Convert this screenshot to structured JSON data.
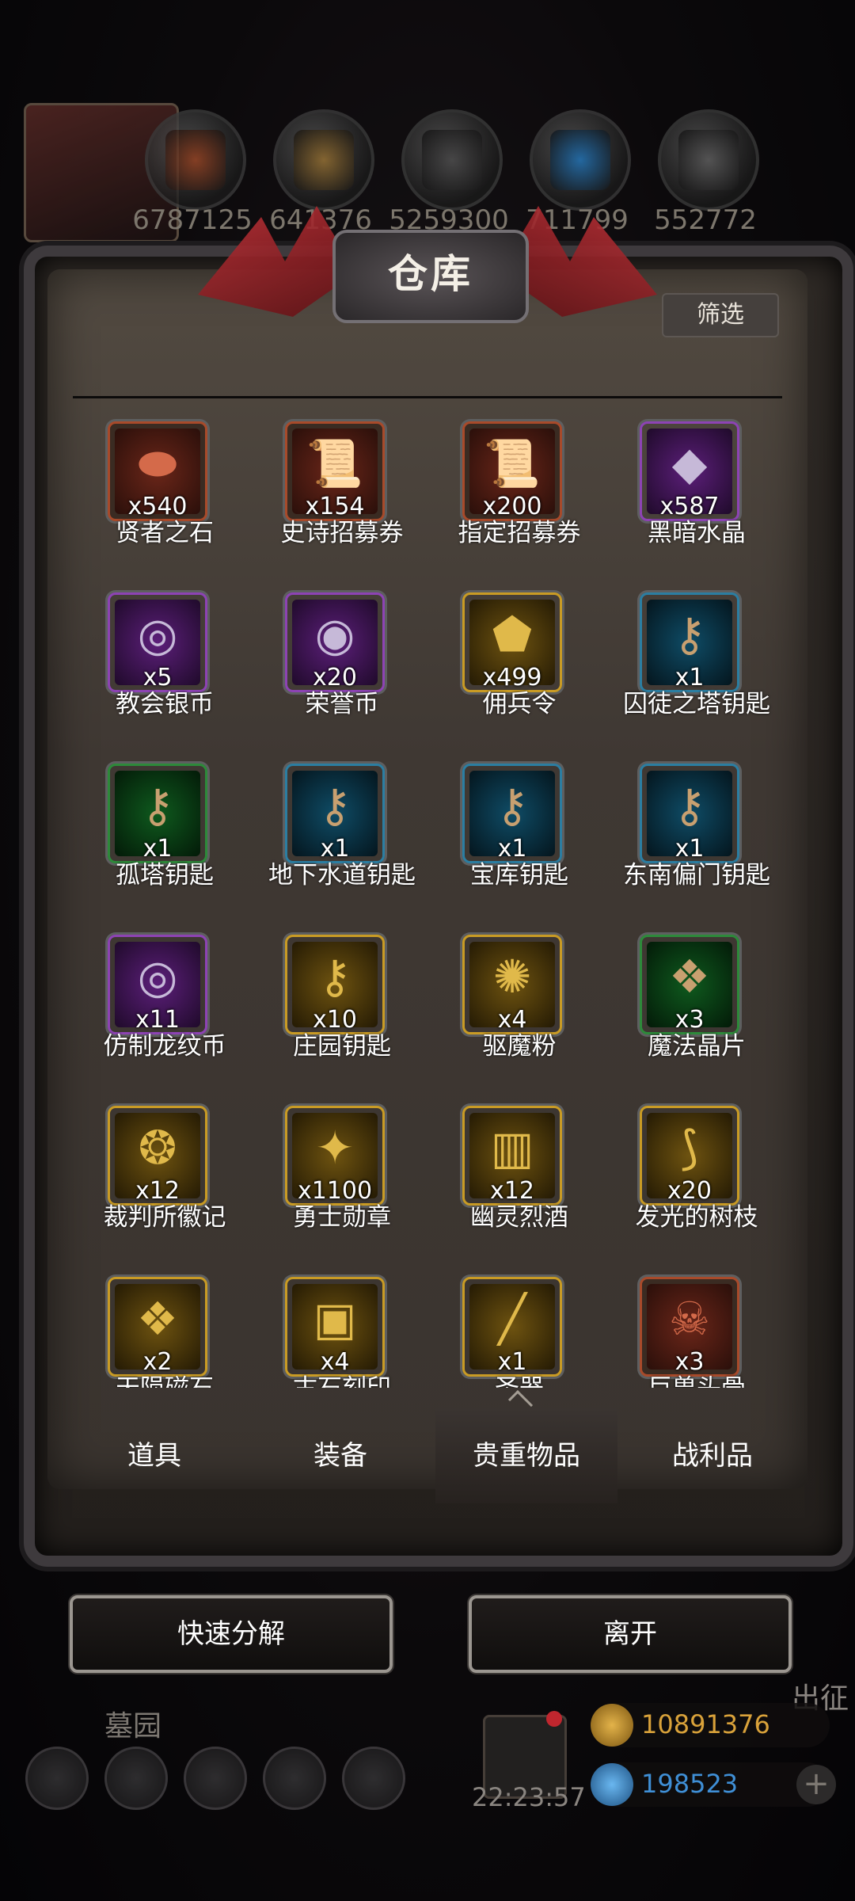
{
  "resources": [
    "6787125",
    "641376",
    "5259300",
    "711799",
    "552772"
  ],
  "window": {
    "title": "仓库",
    "filter_label": "筛选"
  },
  "items": [
    {
      "name": "贤者之石",
      "count": "x540",
      "rarity": "red",
      "glyph": "⬬"
    },
    {
      "name": "史诗招募券",
      "count": "x154",
      "rarity": "red",
      "glyph": "📜"
    },
    {
      "name": "指定招募券",
      "count": "x200",
      "rarity": "red",
      "glyph": "📜"
    },
    {
      "name": "黑暗水晶",
      "count": "x587",
      "rarity": "purple",
      "glyph": "◆"
    },
    {
      "name": "教会银币",
      "count": "x5",
      "rarity": "purple",
      "glyph": "◎"
    },
    {
      "name": "荣誉币",
      "count": "x20",
      "rarity": "purple",
      "glyph": "◉"
    },
    {
      "name": "佣兵令",
      "count": "x499",
      "rarity": "gold",
      "glyph": "⬟"
    },
    {
      "name": "囚徒之塔钥匙",
      "count": "x1",
      "rarity": "blue",
      "glyph": "⚷"
    },
    {
      "name": "孤塔钥匙",
      "count": "x1",
      "rarity": "green",
      "glyph": "⚷"
    },
    {
      "name": "地下水道钥匙",
      "count": "x1",
      "rarity": "blue",
      "glyph": "⚷"
    },
    {
      "name": "宝库钥匙",
      "count": "x1",
      "rarity": "blue",
      "glyph": "⚷"
    },
    {
      "name": "东南偏门钥匙",
      "count": "x1",
      "rarity": "blue",
      "glyph": "⚷"
    },
    {
      "name": "仿制龙纹币",
      "count": "x11",
      "rarity": "purple",
      "glyph": "◎"
    },
    {
      "name": "庄园钥匙",
      "count": "x10",
      "rarity": "gold",
      "glyph": "⚷"
    },
    {
      "name": "驱魔粉",
      "count": "x4",
      "rarity": "gold",
      "glyph": "✺"
    },
    {
      "name": "魔法晶片",
      "count": "x3",
      "rarity": "green",
      "glyph": "❖"
    },
    {
      "name": "裁判所徽记",
      "count": "x12",
      "rarity": "gold",
      "glyph": "❂"
    },
    {
      "name": "勇士勋章",
      "count": "x1100",
      "rarity": "gold",
      "glyph": "✦"
    },
    {
      "name": "幽灵烈酒",
      "count": "x12",
      "rarity": "gold",
      "glyph": "▥"
    },
    {
      "name": "发光的树枝",
      "count": "x20",
      "rarity": "gold",
      "glyph": "⟆"
    },
    {
      "name": "天陨磁石",
      "count": "x2",
      "rarity": "gold",
      "glyph": "❖"
    },
    {
      "name": "古石刻印",
      "count": "x4",
      "rarity": "gold",
      "glyph": "▣"
    },
    {
      "name": "圣器",
      "count": "x1",
      "rarity": "gold",
      "glyph": "╱"
    },
    {
      "name": "巨兽头骨",
      "count": "x3",
      "rarity": "red",
      "glyph": "☠"
    }
  ],
  "tabs": [
    "道具",
    "装备",
    "贵重物品",
    "战利品"
  ],
  "active_tab": 2,
  "buttons": {
    "quick_decompose": "快速分解",
    "leave": "离开"
  },
  "hud": {
    "area_name": "墓园",
    "expedition": "出征",
    "timer": "22:23:57",
    "gold": "10891376",
    "gems": "198523",
    "plus": "+"
  },
  "colors": {
    "gold_text": "#d9a23a",
    "gem_text": "#3f8fd6",
    "accent_red": "#c3343a"
  }
}
